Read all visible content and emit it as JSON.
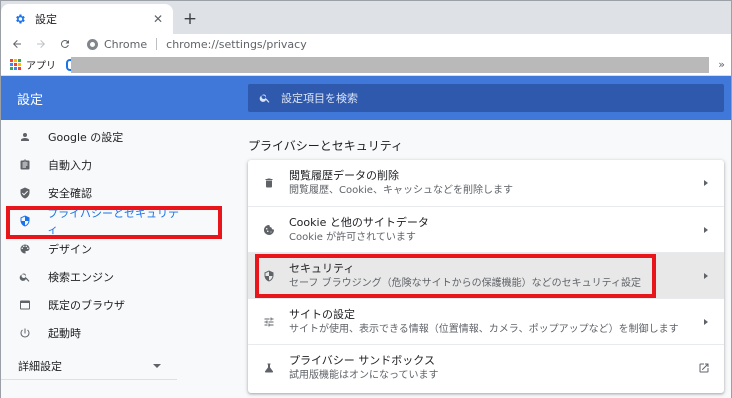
{
  "tab": {
    "title": "設定",
    "close": "✕",
    "new_tab": "+"
  },
  "omnibox": {
    "chip": "Chrome",
    "url": "chrome://settings/privacy"
  },
  "bookmarks": {
    "apps_label": "アプリ",
    "more": "»"
  },
  "header": {
    "title": "設定",
    "search_placeholder": "設定項目を検索"
  },
  "sidebar": {
    "items": [
      {
        "label": "Google の設定",
        "icon": "person-icon"
      },
      {
        "label": "自動入力",
        "icon": "clipboard-icon"
      },
      {
        "label": "安全確認",
        "icon": "shield-check-icon"
      },
      {
        "label": "プライバシーとセキュリティ",
        "icon": "shield-icon",
        "active": true
      },
      {
        "label": "デザイン",
        "icon": "palette-icon"
      },
      {
        "label": "検索エンジン",
        "icon": "search-icon"
      },
      {
        "label": "既定のブラウザ",
        "icon": "browser-icon"
      },
      {
        "label": "起動時",
        "icon": "power-icon"
      }
    ],
    "advanced_label": "詳細設定"
  },
  "main": {
    "section_title": "プライバシーとセキュリティ",
    "rows": [
      {
        "title": "閲覧履歴データの削除",
        "subtitle": "閲覧履歴、Cookie、キャッシュなどを削除します",
        "icon": "trash-icon"
      },
      {
        "title": "Cookie と他のサイトデータ",
        "subtitle": "Cookie が許可されています",
        "icon": "cookie-icon"
      },
      {
        "title": "セキュリティ",
        "subtitle": "セーフ ブラウジング（危険なサイトからの保護機能）などのセキュリティ設定",
        "icon": "shield-icon",
        "selected": true
      },
      {
        "title": "サイトの設定",
        "subtitle": "サイトが使用、表示できる情報（位置情報、カメラ、ポップアップなど）を制御します",
        "icon": "sliders-icon"
      },
      {
        "title": "プライバシー サンドボックス",
        "subtitle": "試用版機能はオンになっています",
        "icon": "flask-icon"
      }
    ]
  },
  "colors": {
    "header": "#3f78d8",
    "accent": "#1a73e8",
    "highlight": "#e8161b"
  }
}
